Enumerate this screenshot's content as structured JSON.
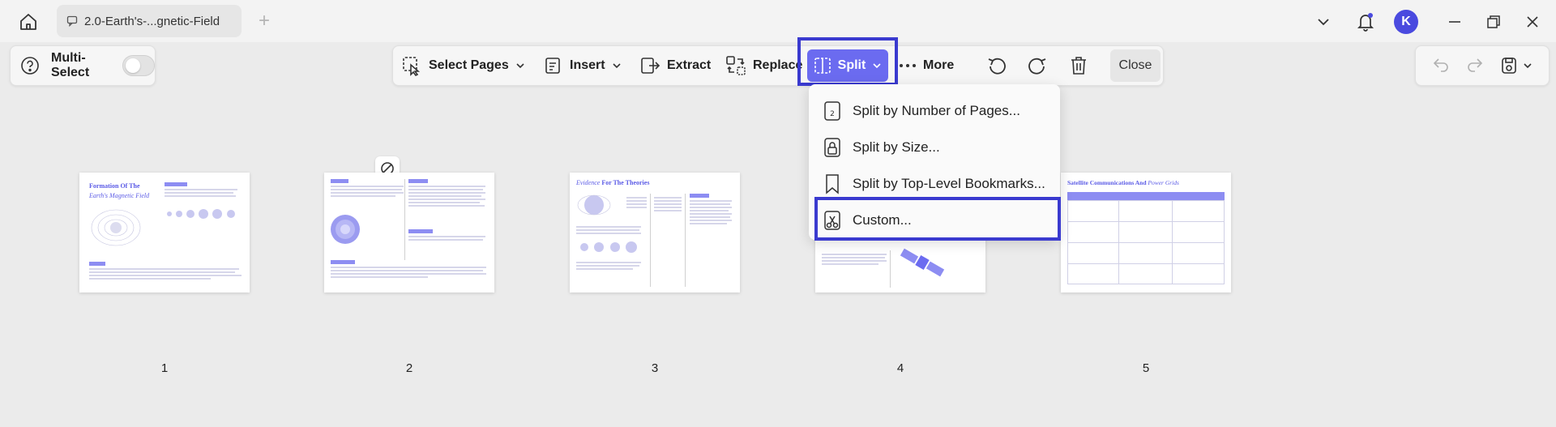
{
  "window": {
    "tab_title": "2.0-Earth's-...gnetic-Field",
    "avatar_letter": "K",
    "accent": "#6b6bf0",
    "highlight": "#3a3acf"
  },
  "left_toolbar": {
    "multi_select_label": "Multi-Select",
    "multi_select_on": false
  },
  "toolbar": {
    "select_pages": "Select Pages",
    "insert": "Insert",
    "extract": "Extract",
    "replace": "Replace",
    "split": "Split",
    "more": "More",
    "close": "Close"
  },
  "split_menu": {
    "items": [
      {
        "label": "Split by Number of Pages...",
        "icon": "number-pages-icon"
      },
      {
        "label": "Split by Size...",
        "icon": "size-icon"
      },
      {
        "label": "Split by Top-Level Bookmarks...",
        "icon": "bookmark-icon"
      },
      {
        "label": "Custom...",
        "icon": "scissors-icon"
      }
    ],
    "highlighted": "Custom..."
  },
  "pages": [
    {
      "number": "1",
      "title_line1": "Formation Of The",
      "title_line2": "Earth's Magnetic Field"
    },
    {
      "number": "2"
    },
    {
      "number": "3",
      "title_part1": "Evidence",
      "title_part2": "For The Theories"
    },
    {
      "number": "4"
    },
    {
      "number": "5",
      "title_part1": "Satellite Communications And",
      "title_part2": "Power Grids"
    }
  ]
}
